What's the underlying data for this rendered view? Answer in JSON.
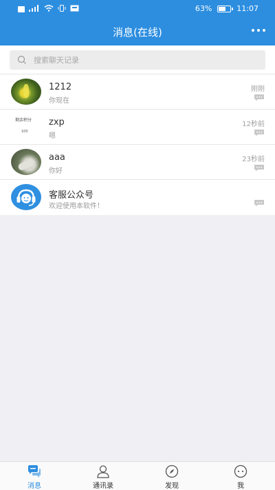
{
  "status_bar": {
    "battery": "63%",
    "battery_level": 0.63,
    "time": "11:07"
  },
  "header": {
    "title": "消息(在线)"
  },
  "search": {
    "placeholder": "搜索聊天记录"
  },
  "chats": [
    {
      "name": "1212",
      "preview": "你现在",
      "time": "刚刚",
      "avatar": "flower-photo-avatar"
    },
    {
      "name": "zxp",
      "preview": "嗯",
      "time": "12秒前",
      "avatar": "score-card-avatar",
      "avatar_text": [
        "剩余积分",
        "100"
      ]
    },
    {
      "name": "aaa",
      "preview": "你好",
      "time": "23秒前",
      "avatar": "hand-photo-avatar"
    },
    {
      "name": "客服公众号",
      "preview": "欢迎使用本软件！",
      "time": "",
      "avatar": "customer-service-avatar"
    }
  ],
  "tabs": [
    {
      "label": "消息",
      "icon": "chat-bubbles-icon",
      "active": true
    },
    {
      "label": "通讯录",
      "icon": "person-icon",
      "active": false
    },
    {
      "label": "发现",
      "icon": "compass-icon",
      "active": false
    },
    {
      "label": "我",
      "icon": "face-icon",
      "active": false
    }
  ],
  "colors": {
    "primary": "#2d8ee0",
    "background": "#efeff4"
  }
}
